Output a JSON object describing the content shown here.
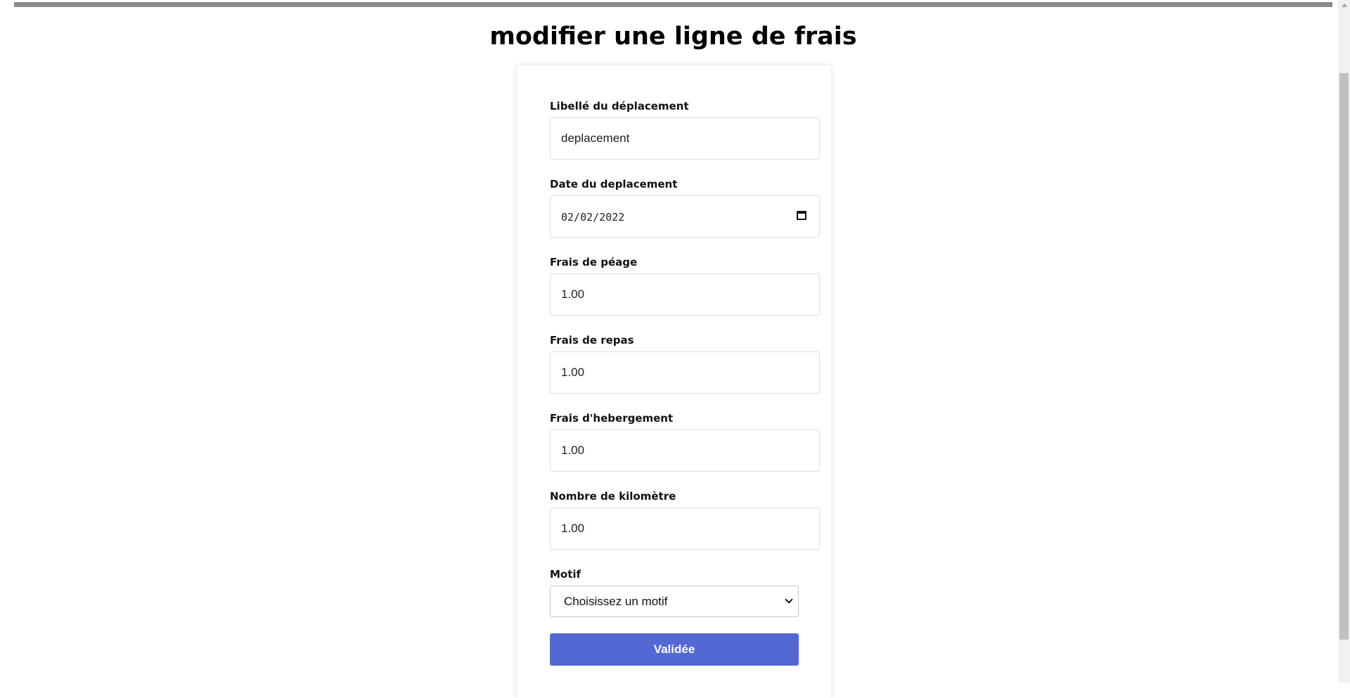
{
  "page": {
    "title": "modifier une ligne de frais"
  },
  "form": {
    "libelle": {
      "label": "Libellé du déplacement",
      "value": "deplacement"
    },
    "date": {
      "label": "Date du deplacement",
      "value": "02/02/2022"
    },
    "peage": {
      "label": "Frais de péage",
      "value": "1.00"
    },
    "repas": {
      "label": "Frais de repas",
      "value": "1.00"
    },
    "hebergement": {
      "label": "Frais d'hebergement",
      "value": "1.00"
    },
    "kilometre": {
      "label": "Nombre de kilomètre",
      "value": "1.00"
    },
    "motif": {
      "label": "Motif",
      "selected": "Choisissez un motif"
    },
    "submit_label": "Validée"
  },
  "colors": {
    "accent": "#5468d4",
    "top_bar": "#8a8a8a"
  },
  "icons": {
    "date_picker": "calendar-icon",
    "select_toggle": "chevron-down-icon"
  }
}
